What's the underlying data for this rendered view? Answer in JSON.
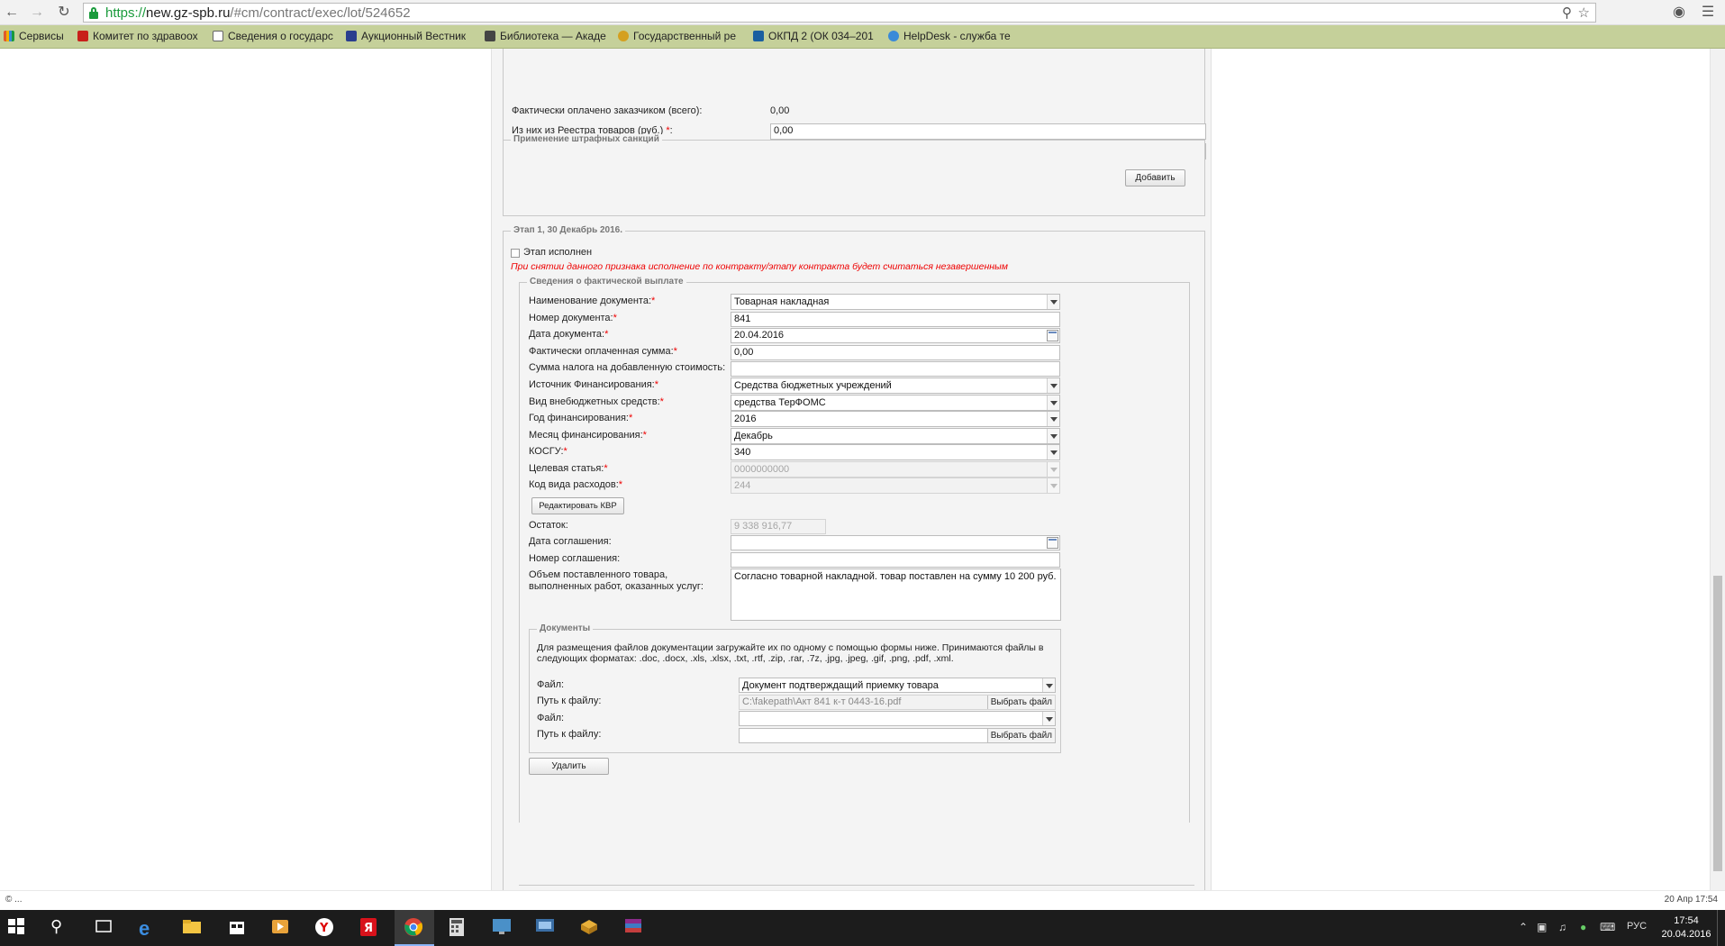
{
  "browser": {
    "url_scheme": "https://",
    "url_host": "new.gz-spb.ru",
    "url_path": "/#cm/contract/exec/lot/524652",
    "bookmarks": [
      {
        "label": "Сервисы",
        "color": "#e05b2c"
      },
      {
        "label": "Комитет по здравоох",
        "color": "#c8201a"
      },
      {
        "label": "Сведения о государс",
        "color": "#ffffff"
      },
      {
        "label": "Аукционный Вестник",
        "color": "#2a3e8e"
      },
      {
        "label": "Библиотека — Акаде",
        "color": "#444444"
      },
      {
        "label": "Государственный ре",
        "color": "#d4a020"
      },
      {
        "label": "ОКПД 2 (ОК 034–201",
        "color": "#1a5fa0"
      },
      {
        "label": "HelpDesk - служба те",
        "color": "#3a8ad8"
      }
    ]
  },
  "top_section": {
    "paid_label": "Фактически оплачено заказчиком (всего):",
    "paid_value": "0,00",
    "registry_label": "Из них из Реестра товаров (руб.) ",
    "registry_value": "0,00",
    "required_mark": "*"
  },
  "penalties": {
    "legend": "Применение штрафных санкций",
    "add_button": "Добавить"
  },
  "stage": {
    "legend": "Этап 1, 30 Декабрь 2016.",
    "checkbox_label": "Этап исполнен",
    "warning": "При снятии данного признака исполнение по контракту/этапу контракта будет считаться незавершенным",
    "payment_legend": "Сведения о фактической выплате",
    "fields": {
      "doc_name_label": "Наименование документа:",
      "doc_name_value": "Товарная накладная",
      "doc_number_label": "Номер документа:",
      "doc_number_value": "841",
      "doc_date_label": "Дата документа:",
      "doc_date_value": "20.04.2016",
      "paid_sum_label": "Фактически оплаченная сумма:",
      "paid_sum_value": "0,00",
      "vat_label": "Сумма налога на добавленную стоимость:",
      "vat_value": "",
      "source_label": "Источник Финансирования:",
      "source_value": "Средства бюджетных учреждений",
      "offbudget_label": "Вид внебюджетных средств:",
      "offbudget_value": "средства ТерФОМС",
      "year_label": "Год финансирования:",
      "year_value": "2016",
      "month_label": "Месяц финансирования:",
      "month_value": "Декабрь",
      "kosgu_label": "КОСГУ:",
      "kosgu_value": "340",
      "target_label": "Целевая статья:",
      "target_value": "0000000000",
      "kvr_label": "Код вида расходов:",
      "kvr_value": "244",
      "edit_kvr_button": "Редактировать КВР",
      "balance_label": "Остаток:",
      "balance_value": "9 338 916,77",
      "agreement_date_label": "Дата соглашения:",
      "agreement_number_label": "Номер соглашения:",
      "volume_label": "Объем поставленного товара, выполненных работ, оказанных услуг:",
      "volume_value": "Согласно товарной накладной. товар поставлен на сумму 10 200 руб."
    },
    "documents": {
      "legend": "Документы",
      "hint": "Для размещения файлов документации загружайте их по одному с помощью формы ниже. Принимаются файлы в следующих форматах: .doc, .docx, .xls, .xlsx, .txt, .rtf, .zip, .rar, .7z, .jpg, .jpeg, .gif, .png, .pdf, .xml.",
      "file_label": "Файл:",
      "path_label": "Путь к файлу:",
      "file1_value": "Документ подтверждащий приемку товара",
      "path1_value": "C:\\fakepath\\Акт 841  к-т 0443-16.pdf",
      "file2_value": "",
      "path2_value": "",
      "choose_file_button": "Выбрать файл"
    },
    "delete_button": "Удалить"
  },
  "status": {
    "left": "© ...",
    "right": "20 Апр 17:54"
  },
  "taskbar": {
    "time": "17:54",
    "date": "20.04.2016",
    "lang": "РУС"
  }
}
